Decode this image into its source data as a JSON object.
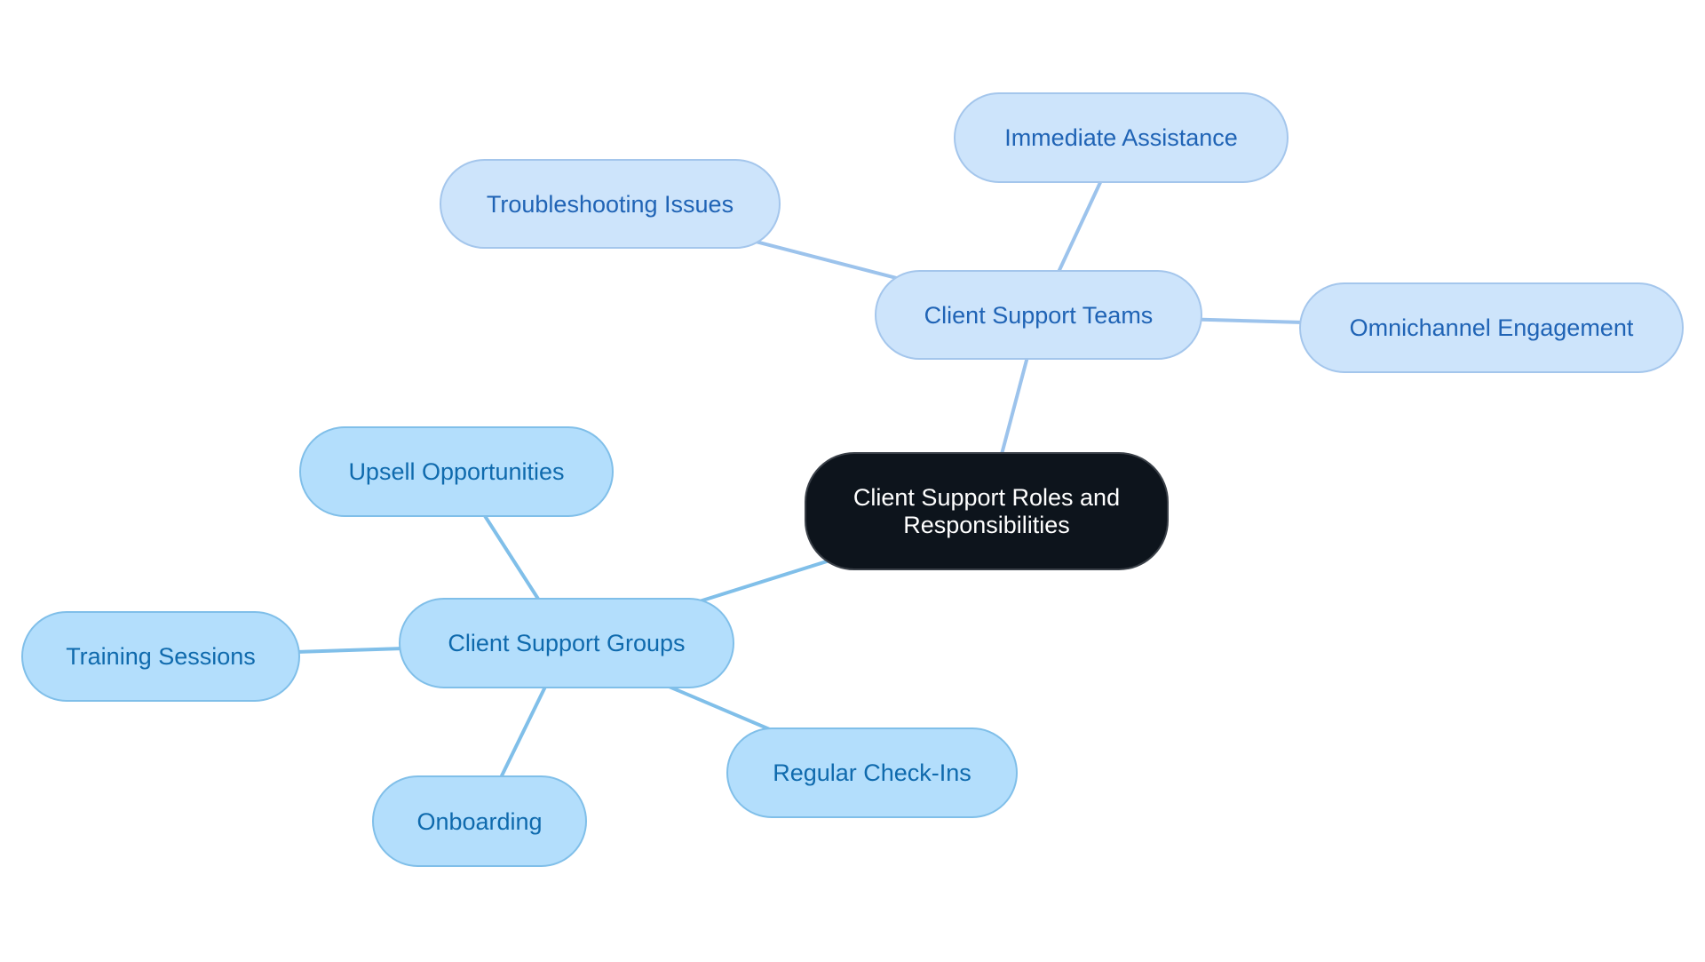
{
  "diagram": {
    "type": "mind-map",
    "root": {
      "id": "root",
      "label": "Client Support Roles and Responsibilities"
    },
    "colors": {
      "root_fill": "#0d141c",
      "root_text": "#ffffff",
      "teams_fill": "#cde4fb",
      "teams_text": "#1f63b5",
      "teams_edge": "#9cc3ec",
      "groups_fill": "#b3defc",
      "groups_text": "#0f6aad",
      "groups_edge": "#80bfe9"
    },
    "branches": [
      {
        "id": "teams",
        "label": "Client Support Teams",
        "children": [
          {
            "id": "immediate",
            "label": "Immediate Assistance"
          },
          {
            "id": "troubleshooting",
            "label": "Troubleshooting Issues"
          },
          {
            "id": "omnichannel",
            "label": "Omnichannel Engagement"
          }
        ]
      },
      {
        "id": "groups",
        "label": "Client Support Groups",
        "children": [
          {
            "id": "upsell",
            "label": "Upsell Opportunities"
          },
          {
            "id": "training",
            "label": "Training Sessions"
          },
          {
            "id": "onboarding",
            "label": "Onboarding"
          },
          {
            "id": "checkins",
            "label": "Regular Check-Ins"
          }
        ]
      }
    ],
    "edges": [
      [
        "root",
        "teams"
      ],
      [
        "root",
        "groups"
      ],
      [
        "teams",
        "immediate"
      ],
      [
        "teams",
        "troubleshooting"
      ],
      [
        "teams",
        "omnichannel"
      ],
      [
        "groups",
        "upsell"
      ],
      [
        "groups",
        "training"
      ],
      [
        "groups",
        "onboarding"
      ],
      [
        "groups",
        "checkins"
      ]
    ]
  }
}
